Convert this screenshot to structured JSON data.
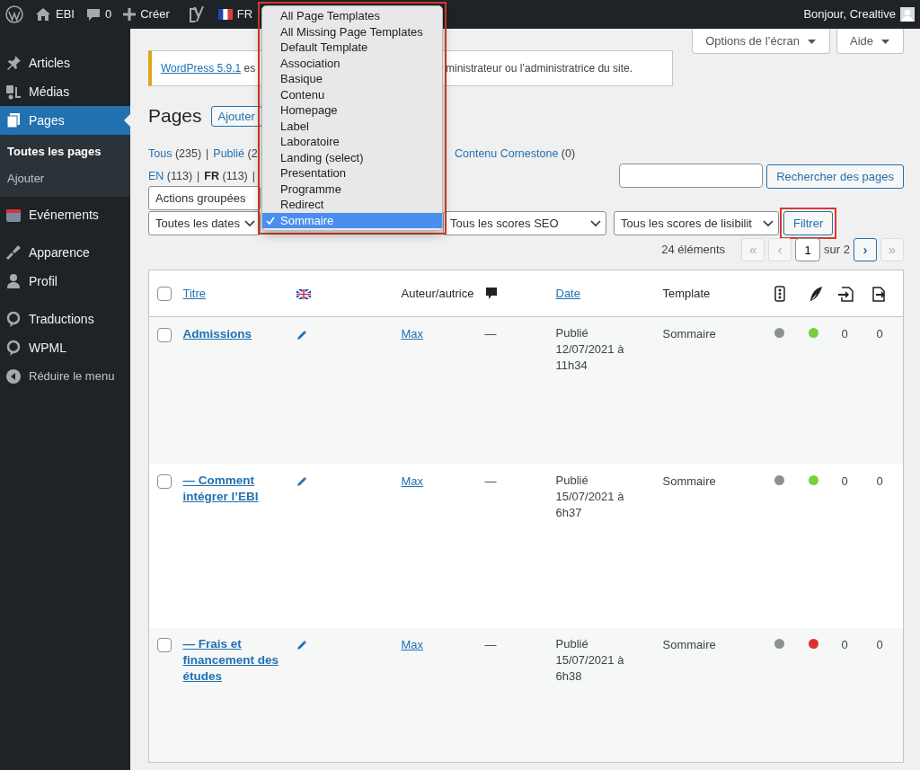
{
  "top_bar": {
    "site": "EBI",
    "comments": "0",
    "new": "Créer",
    "language": "FR",
    "greeting": "Bonjour, Crealtive"
  },
  "sidebar": {
    "items": [
      {
        "label": "Articles",
        "selected": false
      },
      {
        "label": "Médias",
        "selected": false
      },
      {
        "label": "Pages",
        "selected": true,
        "children": [
          {
            "label": "Toutes les pages",
            "selected": true
          },
          {
            "label": "Ajouter",
            "selected": false
          }
        ]
      },
      {
        "label": "Evénements",
        "selected": false
      },
      {
        "label": "Apparence",
        "selected": false
      },
      {
        "label": "Profil",
        "selected": false
      },
      {
        "label": "Traductions",
        "selected": false
      },
      {
        "label": "WPML",
        "selected": false
      }
    ],
    "collapse": "Réduire le menu"
  },
  "screen_tabs": [
    "Options de l’écran",
    "Aide"
  ],
  "notice": {
    "link": "WordPress 5.9.1",
    "text_start": "es",
    "text_end": "ministrateur ou l’administratrice du site."
  },
  "heading": "Pages",
  "add_button": "Ajouter",
  "views": {
    "separator": "|",
    "lines": [
      {
        "items": [
          {
            "label": "Tous",
            "count": "(235)",
            "current": false
          },
          {
            "label": "Publié",
            "count": "(2",
            "current": false
          }
        ],
        "trailing_separator": false,
        "right": [
          {
            "label": "Contenu Cornestone",
            "count": "(0)",
            "current": false
          }
        ]
      },
      {
        "items": [
          {
            "label": "EN",
            "count": "(113)",
            "current": false
          },
          {
            "label": "FR",
            "count": "(113)",
            "current": true
          }
        ],
        "trailing_separator": true
      }
    ]
  },
  "search": {
    "button": "Rechercher des pages"
  },
  "bulk_actions": "Actions groupées",
  "filters": [
    {
      "label": "Toutes les dates"
    },
    {
      "label": "Tous les scores SEO"
    },
    {
      "label": "Tous les scores de lisibilit"
    }
  ],
  "filter_button": {
    "label": "Filtrer",
    "highlighted": true
  },
  "template_menu": {
    "highlighted": true,
    "options": [
      {
        "label": "All Page Templates",
        "selected": false
      },
      {
        "label": "All Missing Page Templates",
        "selected": false
      },
      {
        "label": "Default Template",
        "selected": false
      },
      {
        "label": "Association",
        "selected": false
      },
      {
        "label": "Basique",
        "selected": false
      },
      {
        "label": "Contenu",
        "selected": false
      },
      {
        "label": "Homepage",
        "selected": false
      },
      {
        "label": "Label",
        "selected": false
      },
      {
        "label": "Laboratoire",
        "selected": false
      },
      {
        "label": "Landing (select)",
        "selected": false
      },
      {
        "label": "Presentation",
        "selected": false
      },
      {
        "label": "Programme",
        "selected": false
      },
      {
        "label": "Redirect",
        "selected": false
      },
      {
        "label": "Sommaire",
        "selected": true
      }
    ]
  },
  "pagination": {
    "count": "24 éléments",
    "page": "1",
    "of": "sur 2",
    "buttons": [
      {
        "label": "«",
        "disabled": true
      },
      {
        "label": "‹",
        "disabled": true
      },
      {
        "label": "›",
        "disabled": false
      },
      {
        "label": "»",
        "disabled": true
      }
    ]
  },
  "table": {
    "columns": [
      {
        "kind": "check",
        "checked": false
      },
      {
        "kind": "link",
        "label": "Titre"
      },
      {
        "kind": "flag"
      },
      {
        "kind": "text",
        "label": "Auteur/autrice"
      },
      {
        "kind": "comment"
      },
      {
        "kind": "link",
        "label": "Date"
      },
      {
        "kind": "text",
        "label": "Template"
      },
      {
        "kind": "seo"
      },
      {
        "kind": "readability"
      },
      {
        "kind": "links-in"
      },
      {
        "kind": "links-out"
      }
    ],
    "rows": [
      {
        "checked": false,
        "title": "Admissions",
        "author": "Max",
        "comments": "—",
        "date_lines": [
          "Publié",
          "12/07/2021 à",
          "11h34"
        ],
        "template": "Sommaire",
        "seo": {
          "color": "#8c8f94"
        },
        "readability": {
          "color": "#7ad03a"
        },
        "links_in": "0",
        "links_out": "0"
      },
      {
        "checked": false,
        "title": "— Comment intégrer l’EBI",
        "author": "Max",
        "comments": "—",
        "date_lines": [
          "Publié",
          "15/07/2021 à",
          "6h37"
        ],
        "template": "Sommaire",
        "seo": {
          "color": "#8c8f94"
        },
        "readability": {
          "color": "#7ad03a"
        },
        "links_in": "0",
        "links_out": "0"
      },
      {
        "checked": false,
        "title": "— Frais et financement des études",
        "author": "Max",
        "comments": "—",
        "date_lines": [
          "Publié",
          "15/07/2021 à",
          "6h38"
        ],
        "template": "Sommaire",
        "seo": {
          "color": "#8c8f94"
        },
        "readability": {
          "color": "#dc3232"
        },
        "links_in": "0",
        "links_out": "0"
      }
    ]
  }
}
